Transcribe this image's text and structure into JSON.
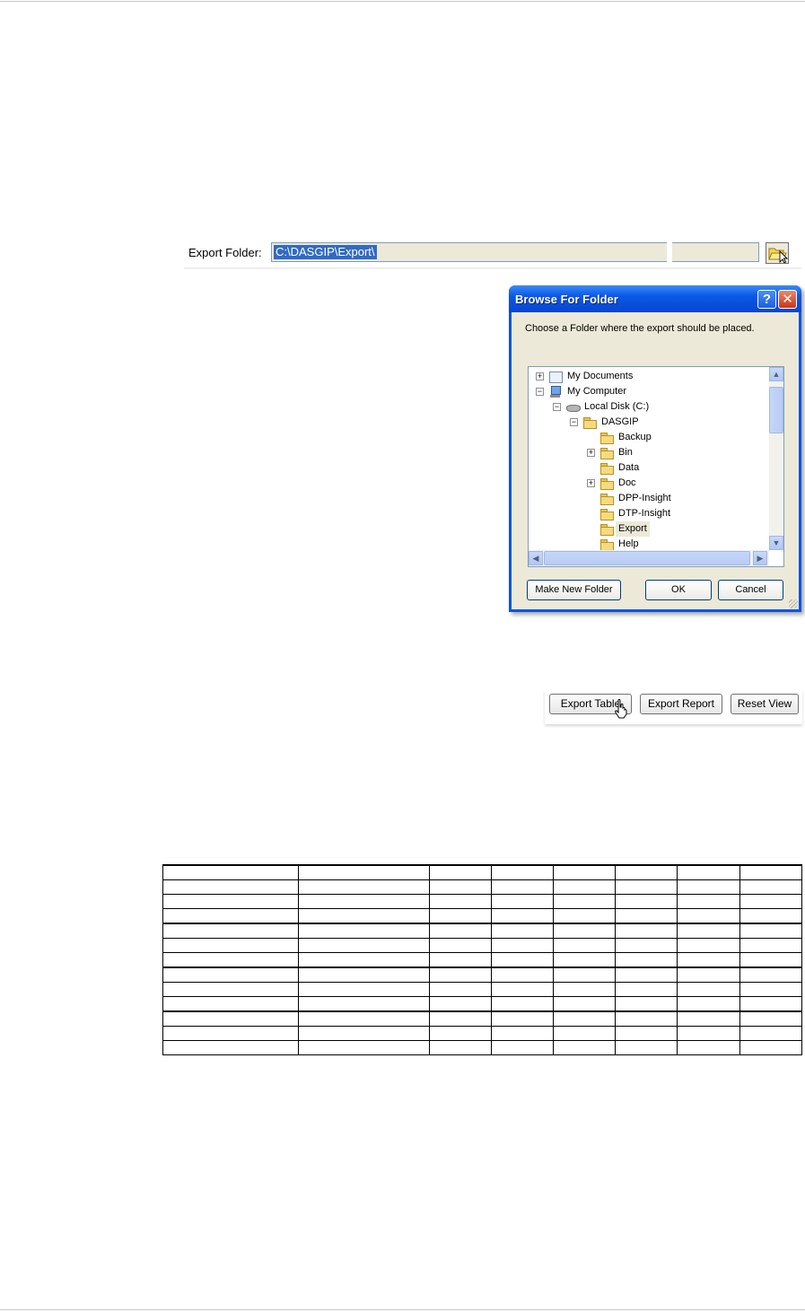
{
  "export_folder": {
    "label": "Export Folder:",
    "value": "C:\\DASGIP\\Export\\"
  },
  "browse_dialog": {
    "title": "Browse For Folder",
    "help_glyph": "?",
    "close_glyph": "✕",
    "prompt": "Choose a Folder where the export should be placed.",
    "tree": [
      {
        "label": "My Documents",
        "icon": "my-documents-icon",
        "expander": "+"
      },
      {
        "label": "My Computer",
        "icon": "my-computer-icon",
        "expander": "−"
      },
      {
        "label": "Local Disk (C:)",
        "icon": "local-disk-icon",
        "expander": "−"
      },
      {
        "label": "DASGIP",
        "icon": "folder-icon",
        "expander": "−"
      },
      {
        "label": "Backup",
        "icon": "folder-icon",
        "expander": ""
      },
      {
        "label": "Bin",
        "icon": "folder-icon",
        "expander": "+"
      },
      {
        "label": "Data",
        "icon": "folder-icon",
        "expander": ""
      },
      {
        "label": "Doc",
        "icon": "folder-icon",
        "expander": "+"
      },
      {
        "label": "DPP-Insight",
        "icon": "folder-icon",
        "expander": ""
      },
      {
        "label": "DTP-Insight",
        "icon": "folder-icon",
        "expander": ""
      },
      {
        "label": "Export",
        "icon": "folder-icon",
        "expander": "",
        "selected": true
      },
      {
        "label": "Help",
        "icon": "folder-icon",
        "expander": ""
      }
    ],
    "buttons": {
      "make_new_folder": "Make New Folder",
      "ok": "OK",
      "cancel": "Cancel"
    }
  },
  "toolbar": {
    "export_table": "Export Table",
    "export_report": "Export Report",
    "reset_view": "Reset View"
  },
  "accent_colors": {
    "titlebar": "#0a58e6",
    "selection": "#316ac5",
    "dialog_face": "#ece9d8"
  }
}
